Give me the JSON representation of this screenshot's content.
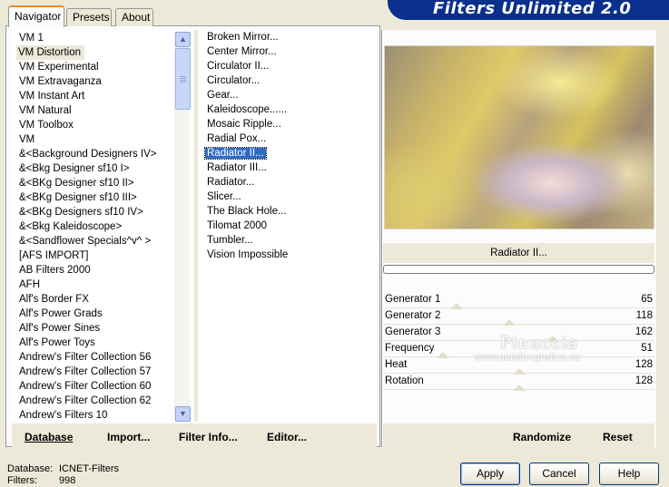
{
  "banner_title": "Filters Unlimited 2.0",
  "tabs": [
    {
      "label": "Navigator",
      "active": true
    },
    {
      "label": "Presets",
      "active": false
    },
    {
      "label": "About",
      "active": false
    }
  ],
  "categories": [
    "VM 1",
    "VM Distortion",
    "VM Experimental",
    "VM Extravaganza",
    "VM Instant Art",
    "VM Natural",
    "VM Toolbox",
    "VM",
    "&<Background Designers IV>",
    "&<Bkg Designer sf10 I>",
    "&<BKg Designer sf10 II>",
    "&<BKg Designer sf10 III>",
    "&<BKg Designers sf10 IV>",
    "&<Bkg Kaleidoscope>",
    "&<Sandflower Specials^v^ >",
    "[AFS IMPORT]",
    "AB Filters 2000",
    "AFH",
    "Alf's Border FX",
    "Alf's Power Grads",
    "Alf's Power Sines",
    "Alf's Power Toys",
    "Andrew's Filter Collection 56",
    "Andrew's Filter Collection 57",
    "Andrew's Filter Collection 60",
    "Andrew's Filter Collection 62",
    "Andrew's Filters 10"
  ],
  "selected_category": "VM Distortion",
  "filters": [
    "Broken Mirror...",
    "Center Mirror...",
    "Circulator II...",
    "Circulator...",
    "Gear...",
    "Kaleidoscope......",
    "Mosaic Ripple...",
    "Radial Pox...",
    "Radiator II...",
    "Radiator III...",
    "Radiator...",
    "Slicer...",
    "The Black Hole...",
    "Tilomat 2000",
    "Tumbler...",
    "Vision Impossible"
  ],
  "selected_filter": "Radiator II...",
  "link_buttons": {
    "database": "Database",
    "import": "Import...",
    "filter_info": "Filter Info...",
    "editor": "Editor..."
  },
  "current_filter_name": "Radiator II...",
  "parameters": [
    {
      "name": "Generator 1",
      "value": 65
    },
    {
      "name": "Generator 2",
      "value": 118
    },
    {
      "name": "Generator 3",
      "value": 162
    },
    {
      "name": "Frequency",
      "value": 51
    },
    {
      "name": "Heat",
      "value": 128
    },
    {
      "name": "Rotation",
      "value": 128
    }
  ],
  "watermark": {
    "name": "Pinuccia",
    "url": "www.maidiregrafica.eu"
  },
  "randomize_label": "Randomize",
  "reset_label": "Reset",
  "status": {
    "database_label": "Database:",
    "database_value": "ICNET-Filters",
    "filters_label": "Filters:",
    "filters_value": "998"
  },
  "buttons": {
    "apply": "Apply",
    "cancel": "Cancel",
    "help": "Help"
  },
  "colors": {
    "banner": "#0a2f8c",
    "selection": "#316ac5",
    "tab_accent": "#e68b2c",
    "window": "#ece9d8"
  }
}
